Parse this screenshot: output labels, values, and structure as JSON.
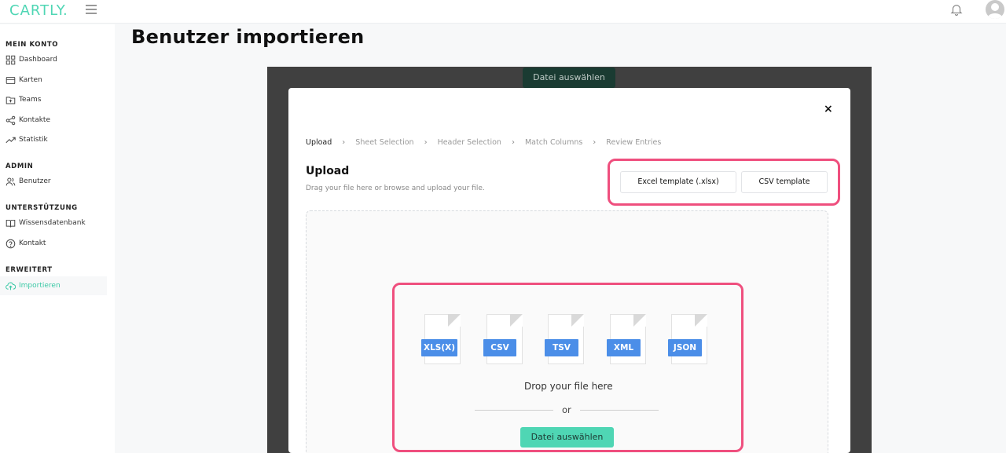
{
  "brand": {
    "logo_text": "CARTLY.",
    "accent": "#4fd6b4"
  },
  "header": {
    "menu_icon": "hamburger-icon",
    "bell_icon": "bell-icon",
    "avatar_icon": "user-avatar"
  },
  "sidebar": {
    "sections": [
      {
        "label": "MEIN KONTO",
        "items": [
          {
            "label": "Dashboard",
            "icon": "grid-icon"
          },
          {
            "label": "Karten",
            "icon": "card-icon"
          },
          {
            "label": "Teams",
            "icon": "folder-plus-icon"
          },
          {
            "label": "Kontakte",
            "icon": "share-icon"
          },
          {
            "label": "Statistik",
            "icon": "trend-icon"
          }
        ]
      },
      {
        "label": "ADMIN",
        "items": [
          {
            "label": "Benutzer",
            "icon": "users-icon"
          }
        ]
      },
      {
        "label": "UNTERSTÜTZUNG",
        "items": [
          {
            "label": "Wissensdatenbank",
            "icon": "book-icon"
          },
          {
            "label": "Kontakt",
            "icon": "help-circle-icon"
          }
        ]
      },
      {
        "label": "ERWEITERT",
        "items": [
          {
            "label": "Importieren",
            "icon": "cloud-upload-icon",
            "active": true
          }
        ]
      }
    ]
  },
  "page": {
    "title": "Benutzer importieren",
    "background_button": "Datei auswählen"
  },
  "modal": {
    "close": "×",
    "steps": [
      "Upload",
      "Sheet Selection",
      "Header Selection",
      "Match Columns",
      "Review Entries"
    ],
    "current_step": "Upload",
    "heading": "Upload",
    "subtitle": "Drag your file here or browse and upload your file.",
    "templates": {
      "excel": "Excel template (.xlsx)",
      "csv": "CSV template"
    },
    "file_types": [
      "XLS(X)",
      "CSV",
      "TSV",
      "XML",
      "JSON"
    ],
    "drop_text": "Drop your file here",
    "or_text": "or",
    "choose_button": "Datei auswählen",
    "highlight_color": "#ef4f7e"
  }
}
